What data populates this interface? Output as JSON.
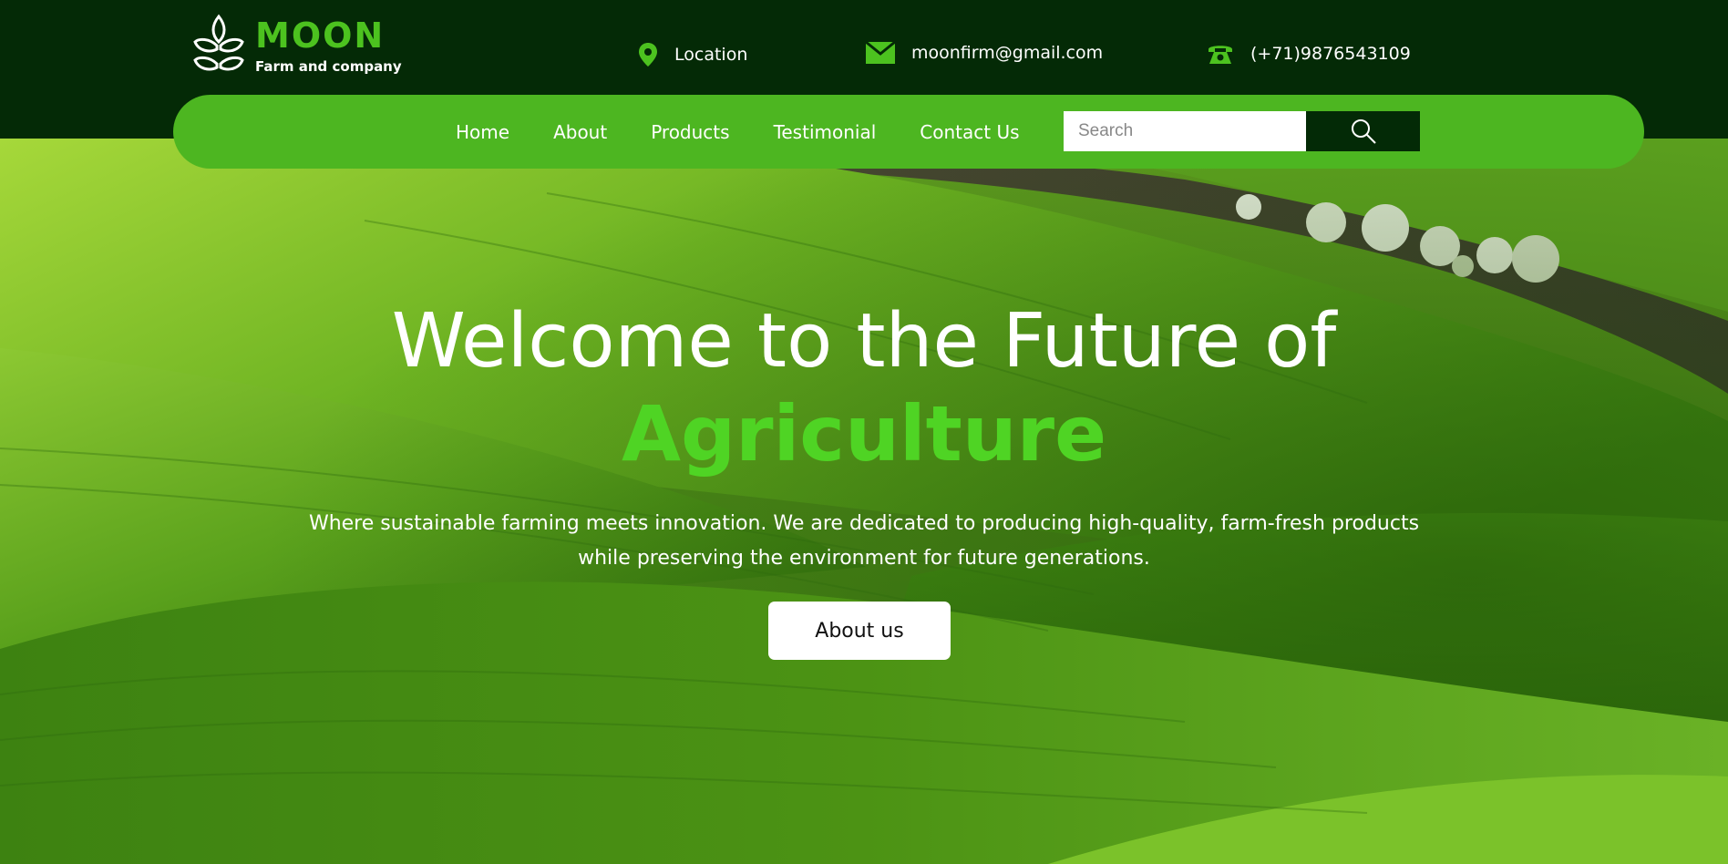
{
  "brand": {
    "name": "MOON",
    "tagline": "Farm and company",
    "accent_color": "#4cc21f"
  },
  "contacts": {
    "location": {
      "icon": "location-pin-icon",
      "label": "Location"
    },
    "email": {
      "icon": "envelope-icon",
      "label": "moonfirm@gmail.com"
    },
    "phone": {
      "icon": "telephone-icon",
      "label": "(+71)9876543109"
    }
  },
  "nav": {
    "items": [
      {
        "label": "Home"
      },
      {
        "label": "About"
      },
      {
        "label": "Products"
      },
      {
        "label": "Testimonial"
      },
      {
        "label": "Contact Us"
      }
    ],
    "search": {
      "placeholder": "Search",
      "value": "",
      "button_icon": "search-icon"
    }
  },
  "hero": {
    "title": "Welcome to the Future of",
    "accent": "Agriculture",
    "description": "Where sustainable farming meets innovation. We are dedicated to producing high-quality, farm-fresh products while preserving the environment for future generations.",
    "button_label": "About us",
    "background": "green-rolling-hills-image"
  },
  "colors": {
    "topbar": "#042a06",
    "nav": "#4db621",
    "accent_text": "#4fd424"
  }
}
